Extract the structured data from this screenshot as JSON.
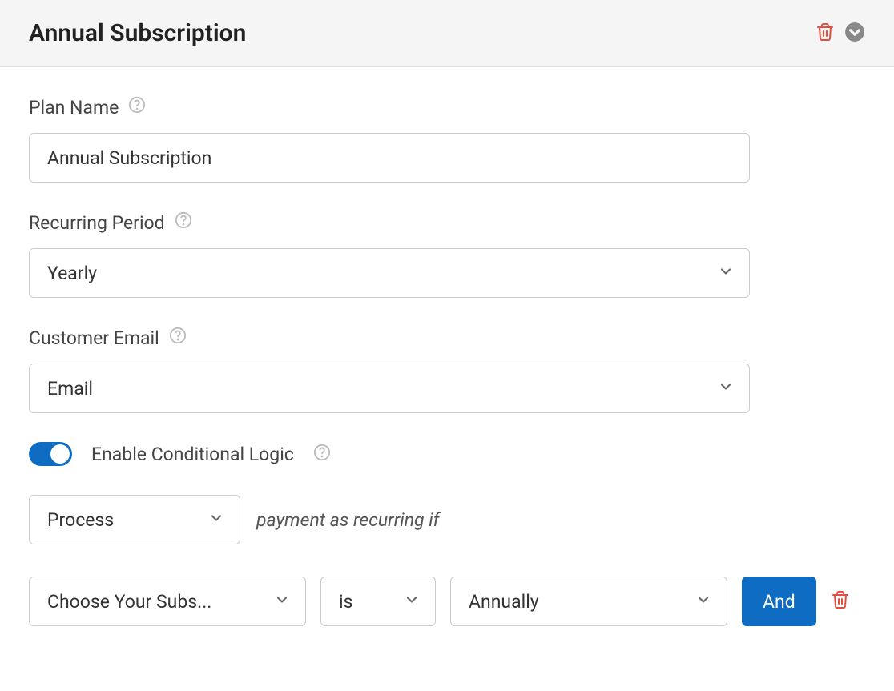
{
  "header": {
    "title": "Annual Subscription"
  },
  "fields": {
    "plan_name": {
      "label": "Plan Name",
      "value": "Annual Subscription"
    },
    "recurring_period": {
      "label": "Recurring Period",
      "selected": "Yearly"
    },
    "customer_email": {
      "label": "Customer Email",
      "selected": "Email"
    }
  },
  "conditional_logic": {
    "toggle_label": "Enable Conditional Logic",
    "enabled": true,
    "action_selected": "Process",
    "middle_text": "payment as recurring if",
    "condition": {
      "field_selected": "Choose Your Subs...",
      "operator_selected": "is",
      "value_selected": "Annually"
    },
    "and_button_label": "And"
  }
}
